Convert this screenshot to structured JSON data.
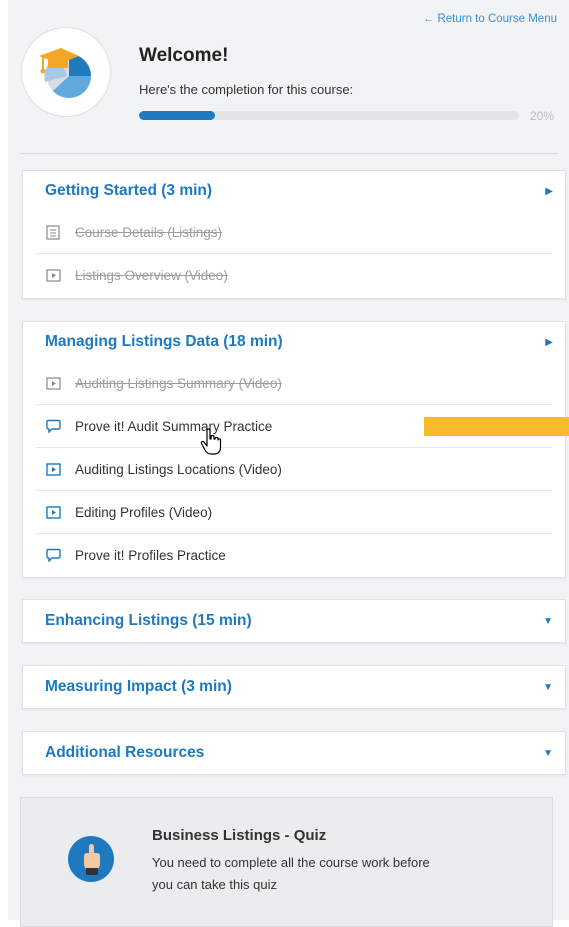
{
  "header": {
    "return_link": "← Return to Course Menu",
    "welcome_title": "Welcome!",
    "welcome_subtitle": "Here's the completion for this course:",
    "progress_fraction": 0.2,
    "progress_label": "20%"
  },
  "colors": {
    "accent": "#1e79bf",
    "highlight": "#f7bb2c",
    "logo_orange": "#f5a623"
  },
  "sections": [
    {
      "title": "Getting Started (3 min)",
      "arrow": "▶",
      "items": [
        {
          "label": "Course Details (Listings)",
          "icon": "document-icon",
          "done": true
        },
        {
          "label": "Listings Overview (Video)",
          "icon": "video-icon",
          "done": true
        }
      ]
    },
    {
      "title": "Managing Listings Data (18 min)",
      "arrow": "▶",
      "items": [
        {
          "label": "Auditing Listings Summary (Video)",
          "icon": "video-icon",
          "done": true
        },
        {
          "label": "Prove it! Audit Summary Practice",
          "icon": "chat-bubble-icon",
          "done": false
        },
        {
          "label": "Auditing Listings Locations (Video)",
          "icon": "video-icon",
          "done": false
        },
        {
          "label": "Editing Profiles (Video)",
          "icon": "video-icon",
          "done": false
        },
        {
          "label": "Prove it! Profiles Practice",
          "icon": "chat-bubble-icon",
          "done": false
        }
      ]
    },
    {
      "title": "Enhancing Listings (15 min)",
      "arrow": "▼",
      "items": []
    },
    {
      "title": "Measuring Impact (3 min)",
      "arrow": "▼",
      "items": []
    },
    {
      "title": "Additional Resources",
      "arrow": "▼",
      "items": []
    }
  ],
  "quiz": {
    "title": "Business Listings - Quiz",
    "message": "You need to complete all the course work before you can take this quiz",
    "icon": "pointing-hand-icon"
  }
}
